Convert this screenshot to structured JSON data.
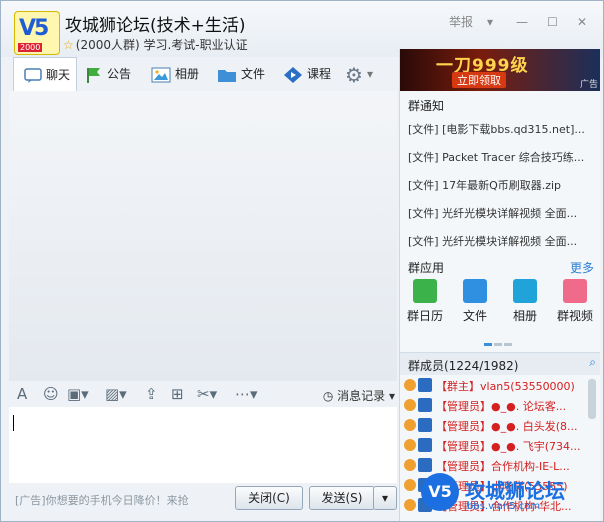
{
  "group": {
    "title": "攻城狮论坛(技术+生活)",
    "subtitle": "(2000人群) 学习.考试-职业认证",
    "logo_text": "V5",
    "logo_year": "2000"
  },
  "window_controls": {
    "report": "举报"
  },
  "tabs": [
    {
      "label": "聊天",
      "icon": "chat-bubble-icon"
    },
    {
      "label": "公告",
      "icon": "flag-icon"
    },
    {
      "label": "相册",
      "icon": "photo-icon"
    },
    {
      "label": "文件",
      "icon": "folder-icon"
    },
    {
      "label": "课程",
      "icon": "play-course-icon"
    }
  ],
  "toolbar": {
    "history_label": "消息记录"
  },
  "input": {
    "placeholder": ""
  },
  "bottom": {
    "ad_text": "[广告]你想要的手机今日降价！来抢",
    "close_label": "关闭(C)",
    "send_label": "发送(S)"
  },
  "banner": {
    "headline": "一刀999级",
    "cta": "立即领取",
    "tag": "广告"
  },
  "right": {
    "notice_title": "群通知",
    "notices": [
      "[文件] [电影下载bbs.qd315.net]...",
      "[文件] Packet Tracer 综合技巧练...",
      "[文件] 17年最新Q币刷取器.zip",
      "[文件] 光纤光模块详解视频 全面...",
      "[文件] 光纤光模块详解视频 全面..."
    ],
    "apps_title": "群应用",
    "apps_more": "更多",
    "apps": [
      {
        "label": "群日历",
        "color": "#3cb34a"
      },
      {
        "label": "文件",
        "color": "#2f8fe0"
      },
      {
        "label": "相册",
        "color": "#1fa3d8"
      },
      {
        "label": "群视频",
        "color": "#f06a8a"
      }
    ],
    "members_title": "群成员(1224/1982)",
    "members": [
      {
        "role": "【群主】",
        "name": "vlan5(53550000)"
      },
      {
        "role": "【管理员】",
        "name": "●_●. 论坛客..."
      },
      {
        "role": "【管理员】",
        "name": "●_●. 白头发(8..."
      },
      {
        "role": "【管理员】",
        "name": "●_●. 飞宇(734..."
      },
      {
        "role": "【管理员】",
        "name": "合作机构-IE-L..."
      },
      {
        "role": "【管理员】",
        "name": "小吃货(55555)"
      },
      {
        "role": "【管理员】",
        "name": "合作机构-华北..."
      }
    ]
  },
  "watermark": {
    "text": "攻城狮论坛",
    "url": "bbs.vlan5.com",
    "badge": "V5"
  }
}
